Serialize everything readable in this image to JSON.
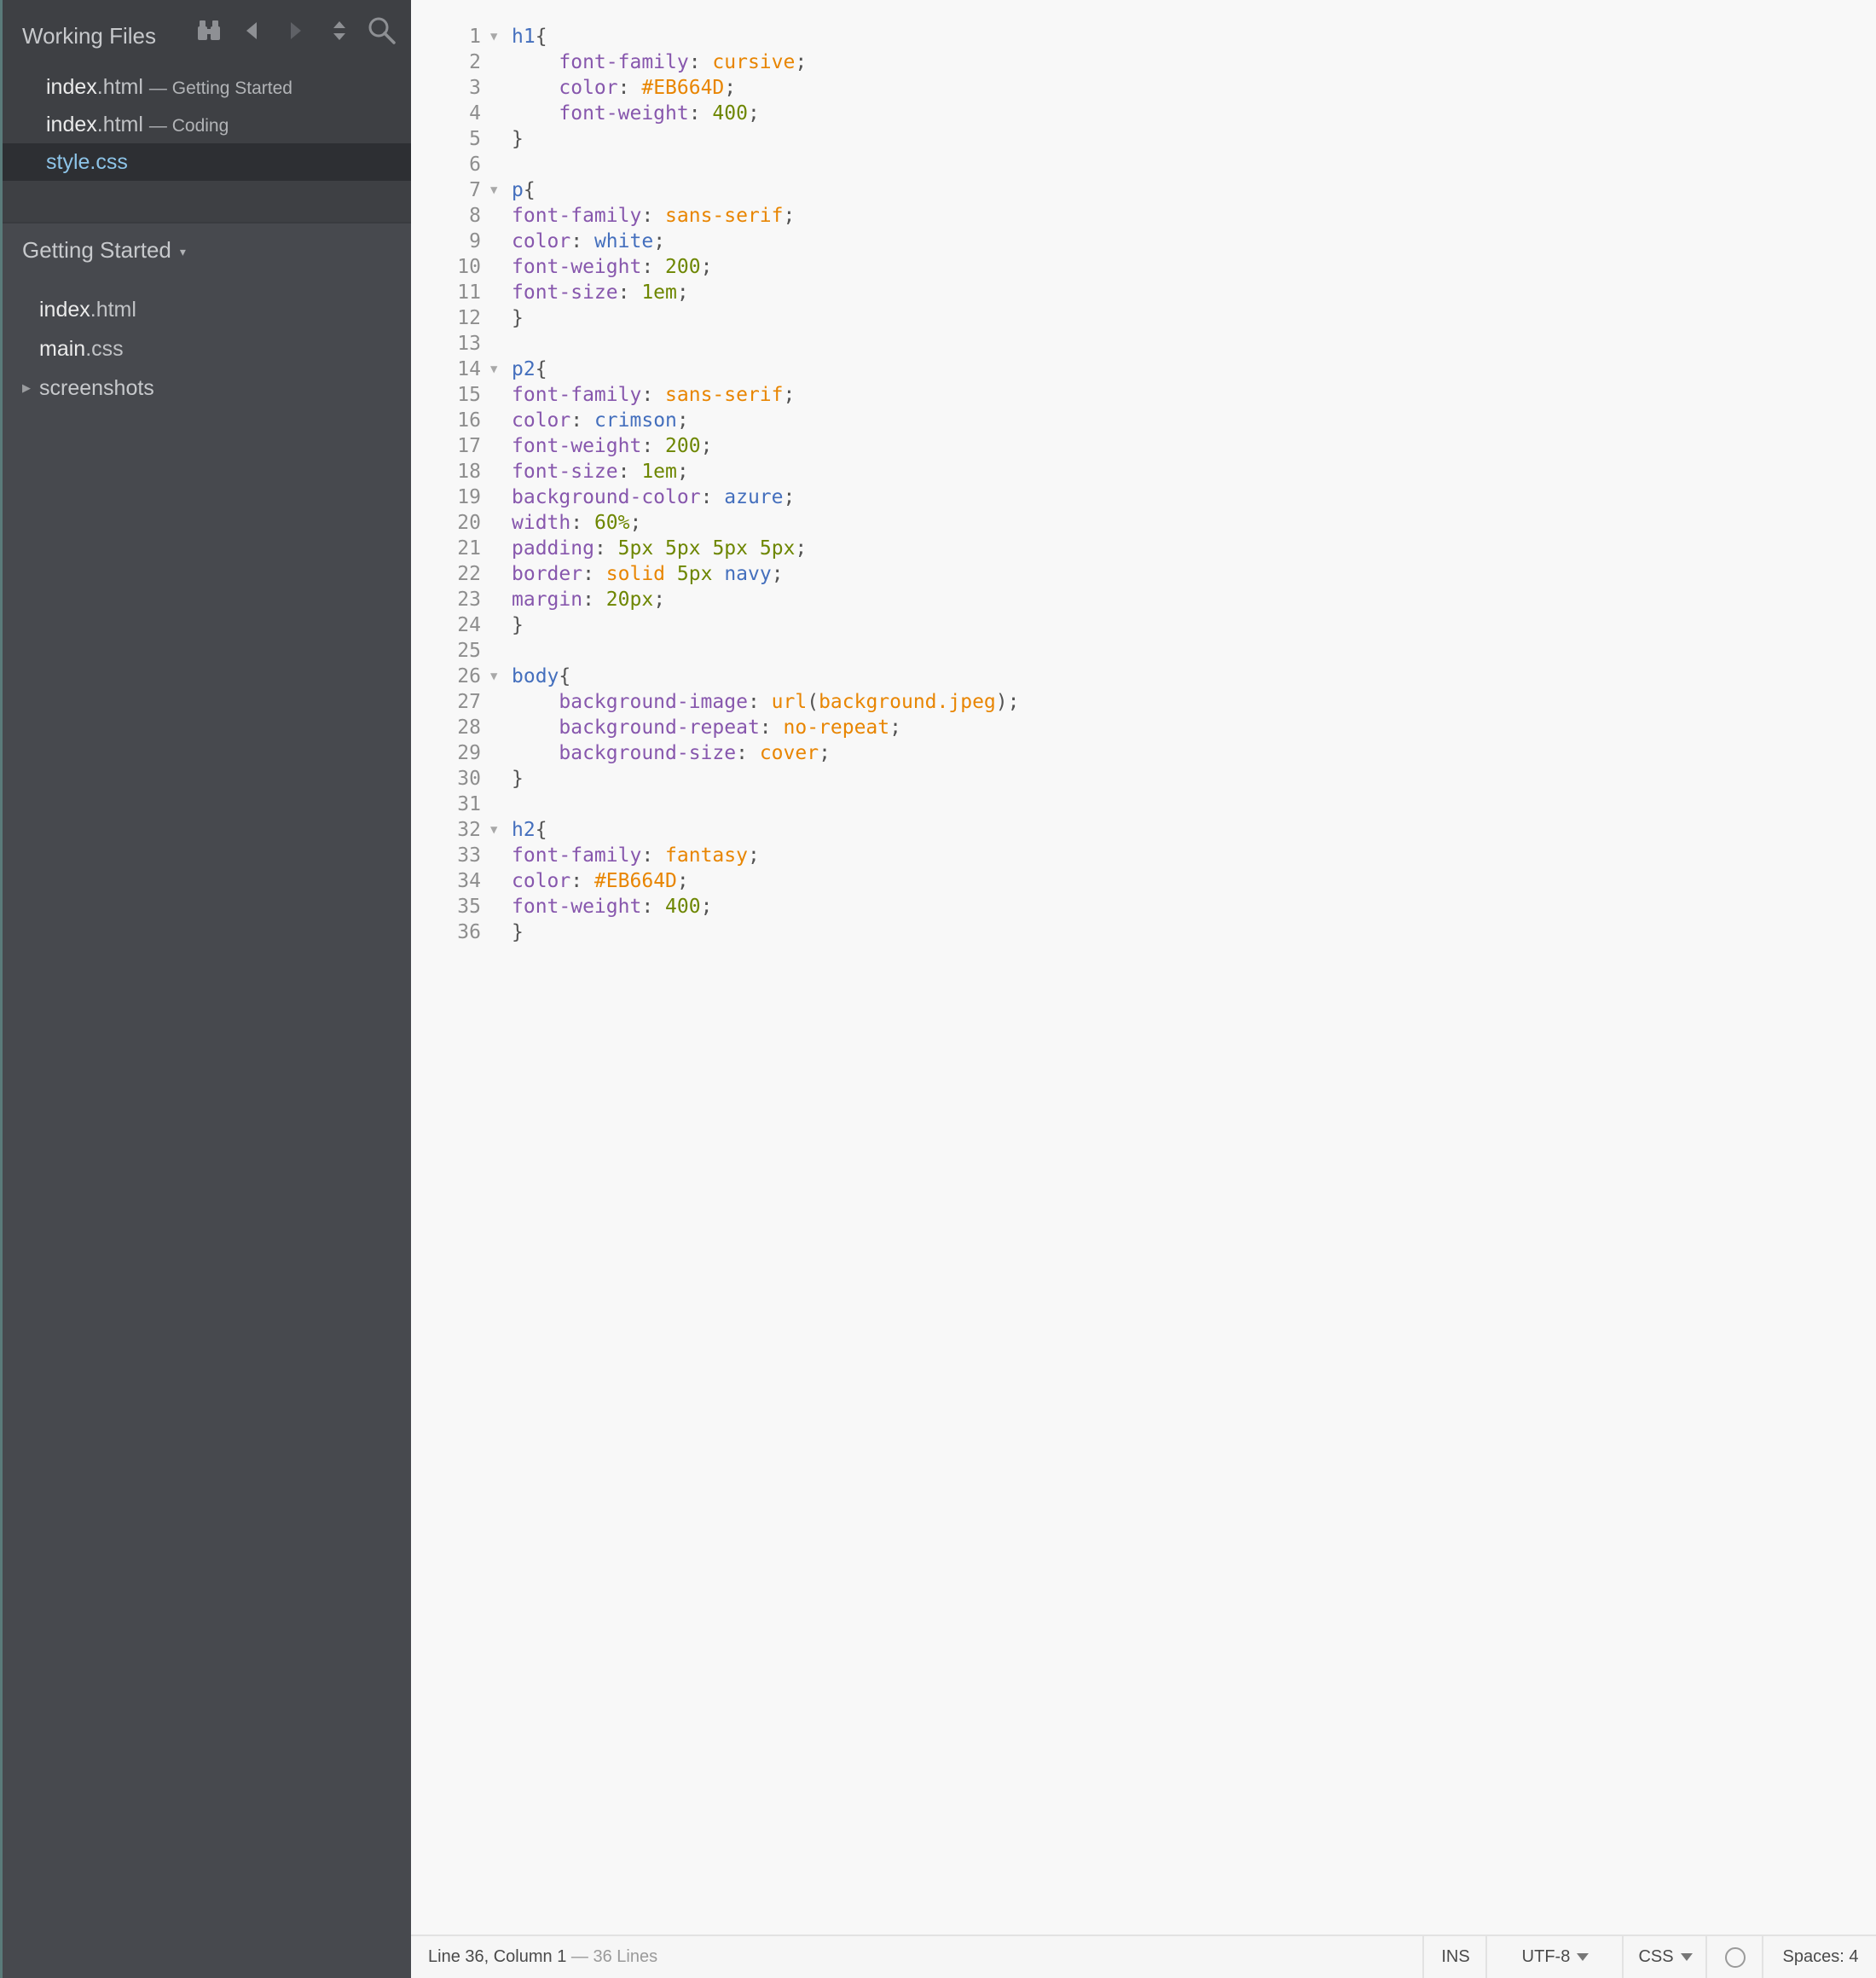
{
  "sidebar": {
    "working_files_title": "Working Files",
    "working_files": [
      {
        "name": "index",
        "ext": ".html",
        "context": "— Getting Started",
        "active": false
      },
      {
        "name": "index",
        "ext": ".html",
        "context": "— Coding",
        "active": false
      },
      {
        "name": "style",
        "ext": ".css",
        "context": "",
        "active": true
      }
    ],
    "project": {
      "name": "Getting Started",
      "caret": "▾"
    },
    "tree": [
      {
        "name": "index",
        "ext": ".html"
      },
      {
        "name": "main",
        "ext": ".css"
      },
      {
        "name": "screenshots",
        "ext": "",
        "folder": true,
        "disclosure": "▶"
      }
    ],
    "tools": [
      "binoculars-icon",
      "back-icon",
      "forward-icon",
      "split-sort-icon",
      "search-icon"
    ]
  },
  "editor": {
    "lines": [
      [
        [
          "sel",
          "h1"
        ],
        [
          "p",
          "{"
        ]
      ],
      [
        [
          "ws",
          "    "
        ],
        [
          "prop",
          "font-family"
        ],
        [
          "p",
          ": "
        ],
        [
          "val",
          "cursive"
        ],
        [
          "p",
          ";"
        ]
      ],
      [
        [
          "ws",
          "    "
        ],
        [
          "prop",
          "color"
        ],
        [
          "p",
          ": "
        ],
        [
          "val",
          "#EB664D"
        ],
        [
          "p",
          ";"
        ]
      ],
      [
        [
          "ws",
          "    "
        ],
        [
          "prop",
          "font-weight"
        ],
        [
          "p",
          ": "
        ],
        [
          "num",
          "400"
        ],
        [
          "p",
          ";"
        ]
      ],
      [
        [
          "p",
          "}"
        ]
      ],
      [],
      [
        [
          "sel",
          "p"
        ],
        [
          "p",
          "{"
        ]
      ],
      [
        [
          "prop",
          "font-family"
        ],
        [
          "p",
          ": "
        ],
        [
          "val",
          "sans-serif"
        ],
        [
          "p",
          ";"
        ]
      ],
      [
        [
          "prop",
          "color"
        ],
        [
          "p",
          ": "
        ],
        [
          "kw",
          "white"
        ],
        [
          "p",
          ";"
        ]
      ],
      [
        [
          "prop",
          "font-weight"
        ],
        [
          "p",
          ": "
        ],
        [
          "num",
          "200"
        ],
        [
          "p",
          ";"
        ]
      ],
      [
        [
          "prop",
          "font-size"
        ],
        [
          "p",
          ": "
        ],
        [
          "num",
          "1em"
        ],
        [
          "p",
          ";"
        ]
      ],
      [
        [
          "p",
          "}"
        ]
      ],
      [],
      [
        [
          "sel",
          "p2"
        ],
        [
          "p",
          "{"
        ]
      ],
      [
        [
          "prop",
          "font-family"
        ],
        [
          "p",
          ": "
        ],
        [
          "val",
          "sans-serif"
        ],
        [
          "p",
          ";"
        ]
      ],
      [
        [
          "prop",
          "color"
        ],
        [
          "p",
          ": "
        ],
        [
          "kw",
          "crimson"
        ],
        [
          "p",
          ";"
        ]
      ],
      [
        [
          "prop",
          "font-weight"
        ],
        [
          "p",
          ": "
        ],
        [
          "num",
          "200"
        ],
        [
          "p",
          ";"
        ]
      ],
      [
        [
          "prop",
          "font-size"
        ],
        [
          "p",
          ": "
        ],
        [
          "num",
          "1em"
        ],
        [
          "p",
          ";"
        ]
      ],
      [
        [
          "prop",
          "background-color"
        ],
        [
          "p",
          ": "
        ],
        [
          "kw",
          "azure"
        ],
        [
          "p",
          ";"
        ]
      ],
      [
        [
          "prop",
          "width"
        ],
        [
          "p",
          ": "
        ],
        [
          "num",
          "60%"
        ],
        [
          "p",
          ";"
        ]
      ],
      [
        [
          "prop",
          "padding"
        ],
        [
          "p",
          ": "
        ],
        [
          "num",
          "5px"
        ],
        [
          "p",
          " "
        ],
        [
          "num",
          "5px"
        ],
        [
          "p",
          " "
        ],
        [
          "num",
          "5px"
        ],
        [
          "p",
          " "
        ],
        [
          "num",
          "5px"
        ],
        [
          "p",
          ";"
        ]
      ],
      [
        [
          "prop",
          "border"
        ],
        [
          "p",
          ": "
        ],
        [
          "val",
          "solid"
        ],
        [
          "p",
          " "
        ],
        [
          "num",
          "5px"
        ],
        [
          "p",
          " "
        ],
        [
          "kw",
          "navy"
        ],
        [
          "p",
          ";"
        ]
      ],
      [
        [
          "prop",
          "margin"
        ],
        [
          "p",
          ": "
        ],
        [
          "num",
          "20px"
        ],
        [
          "p",
          ";"
        ]
      ],
      [
        [
          "p",
          "}"
        ]
      ],
      [],
      [
        [
          "sel",
          "body"
        ],
        [
          "p",
          "{"
        ]
      ],
      [
        [
          "ws",
          "    "
        ],
        [
          "prop",
          "background-image"
        ],
        [
          "p",
          ": "
        ],
        [
          "val",
          "url"
        ],
        [
          "p",
          "("
        ],
        [
          "val",
          "background.jpeg"
        ],
        [
          "p",
          ");"
        ]
      ],
      [
        [
          "ws",
          "    "
        ],
        [
          "prop",
          "background-repeat"
        ],
        [
          "p",
          ": "
        ],
        [
          "val",
          "no-repeat"
        ],
        [
          "p",
          ";"
        ]
      ],
      [
        [
          "ws",
          "    "
        ],
        [
          "prop",
          "background-size"
        ],
        [
          "p",
          ": "
        ],
        [
          "val",
          "cover"
        ],
        [
          "p",
          ";"
        ]
      ],
      [
        [
          "p",
          "}"
        ]
      ],
      [],
      [
        [
          "sel",
          "h2"
        ],
        [
          "p",
          "{"
        ]
      ],
      [
        [
          "prop",
          "font-family"
        ],
        [
          "p",
          ": "
        ],
        [
          "val",
          "fantasy"
        ],
        [
          "p",
          ";"
        ]
      ],
      [
        [
          "prop",
          "color"
        ],
        [
          "p",
          ": "
        ],
        [
          "val",
          "#EB664D"
        ],
        [
          "p",
          ";"
        ]
      ],
      [
        [
          "prop",
          "font-weight"
        ],
        [
          "p",
          ": "
        ],
        [
          "num",
          "400"
        ],
        [
          "p",
          ";"
        ]
      ],
      [
        [
          "p",
          "}"
        ]
      ]
    ],
    "fold_lines": [
      1,
      7,
      14,
      26,
      32
    ],
    "fold_glyph": "▼"
  },
  "statusbar": {
    "position": "Line 36, Column 1",
    "line_count": "— 36 Lines",
    "mode": "INS",
    "encoding": "UTF-8",
    "language": "CSS",
    "indent_label": "Spaces:",
    "indent_value": "4"
  },
  "colors": {
    "sidebar_bg": "#47494e",
    "sidebar_header_bg": "#3e4044",
    "active_file": "#8dc4e8",
    "selector": "#446fbd",
    "property": "#8757ad",
    "value": "#e88501",
    "number": "#6d8600"
  }
}
